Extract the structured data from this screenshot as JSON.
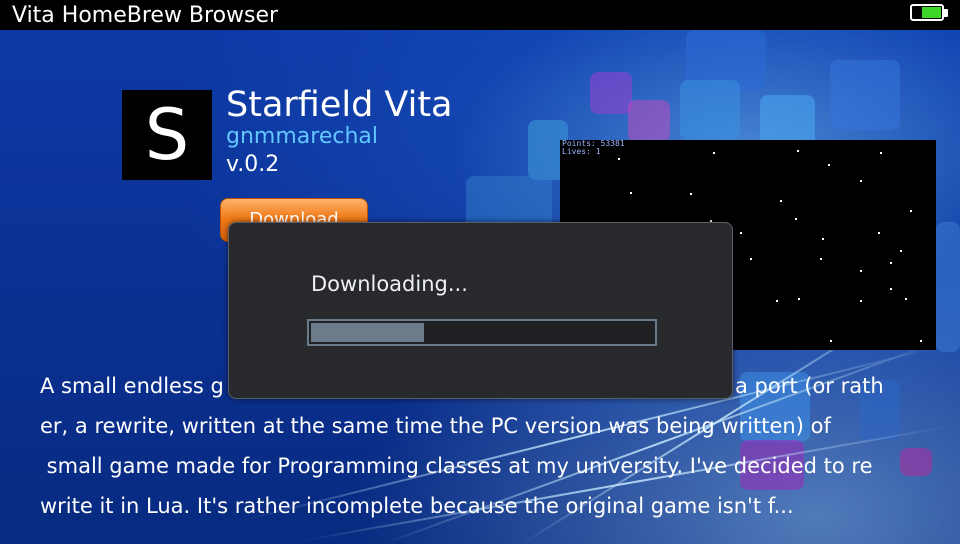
{
  "statusbar": {
    "app_title": "Vita HomeBrew Browser",
    "battery_level": 0.75,
    "battery_color": "#3fd62a"
  },
  "app": {
    "icon_letter": "S",
    "name": "Starfield Vita",
    "author": "gnmmarechal",
    "version": "v.0.2",
    "author_color": "#62c6ff"
  },
  "download_button": {
    "label": "Download",
    "color": "#f07a1a"
  },
  "preview": {
    "hud_line1": "Points: 53381",
    "hud_line2": "Lives: 1"
  },
  "description": {
    "lines": [
      "A small endless g",
      "a port (or rath",
      "er, a rewrite, written at the same time the PC version was being written) of",
      " small game made for Programming classes at my university. I've decided to re",
      "write it in Lua. It's rather incomplete because the original game isn't f..."
    ]
  },
  "dialog": {
    "title": "Downloading...",
    "progress": 0.33
  }
}
